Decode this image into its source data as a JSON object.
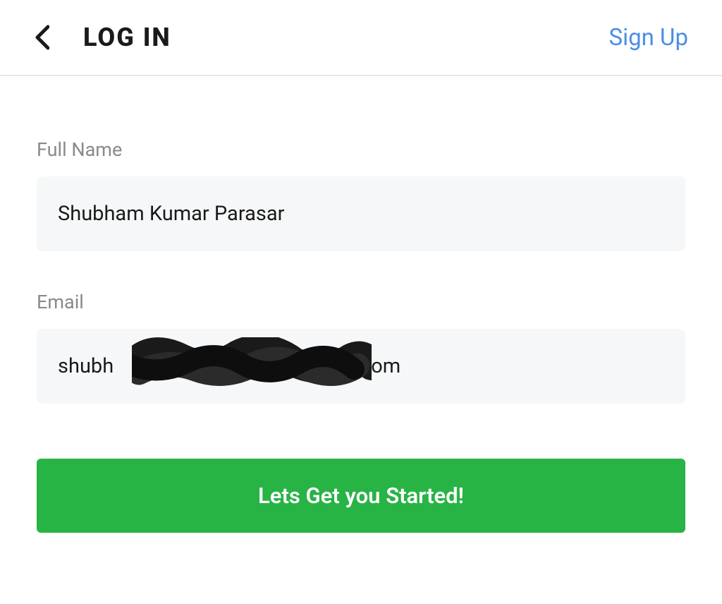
{
  "header": {
    "title": "LOG IN",
    "signup_label": "Sign Up"
  },
  "form": {
    "fullname": {
      "label": "Full Name",
      "value": "Shubham Kumar Parasar"
    },
    "email": {
      "label": "Email",
      "prefix": "shubh",
      "suffix": "gmail.com"
    },
    "cta_label": "Lets Get you Started!"
  }
}
